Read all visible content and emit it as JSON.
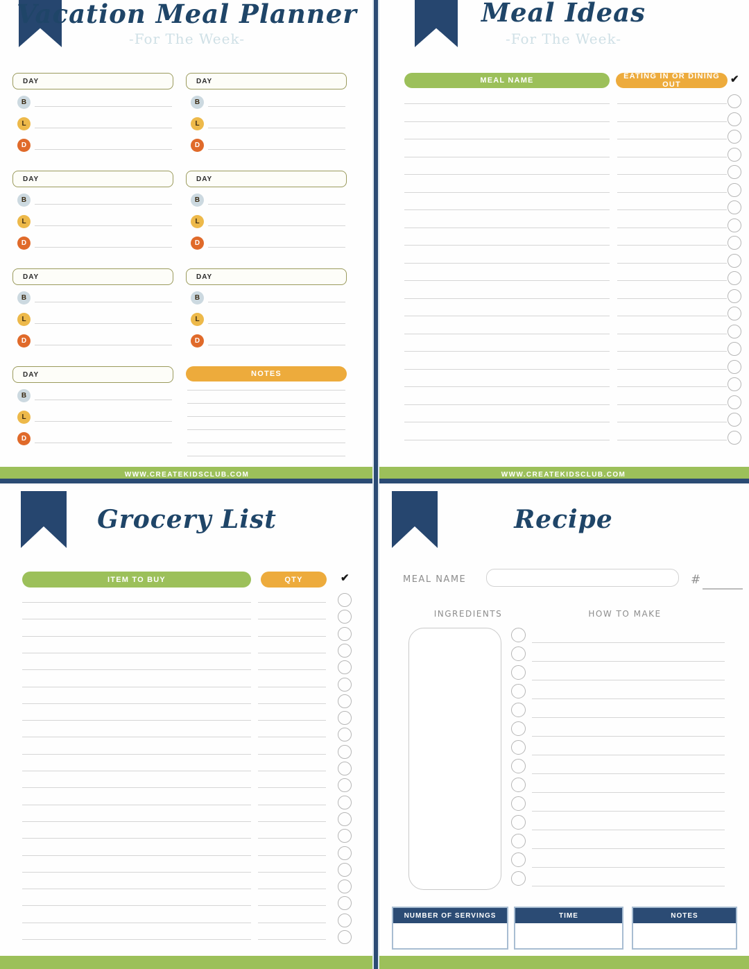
{
  "brand": {
    "footer_url": "WWW.CREATEKIDSCLUB.COM",
    "colors": {
      "navy": "#26466f",
      "green": "#9cc05a",
      "amber": "#edab3c",
      "olive": "#9a9a5c",
      "breakfast": "#ccd9e0",
      "lunch": "#edb94a",
      "dinner": "#e06a2a",
      "subtitle_blue": "#cfe0e6"
    }
  },
  "meal_planner": {
    "title": "Vacation Meal Planner",
    "subtitle": "-For The Week-",
    "day_label": "DAY",
    "meal_codes": {
      "breakfast": "B",
      "lunch": "L",
      "dinner": "D"
    },
    "day_count": 7,
    "notes_label": "NOTES",
    "notes_line_count": 6
  },
  "meal_ideas": {
    "title": "Meal Ideas",
    "subtitle": "-For The Week-",
    "columns": {
      "meal_name": "MEAL NAME",
      "eating_in_or_out": "EATING IN OR DINING OUT",
      "check": "✔"
    },
    "row_count": 20
  },
  "grocery_list": {
    "title": "Grocery List",
    "columns": {
      "item_to_buy": "ITEM TO BUY",
      "qty": "QTY",
      "check": "✔"
    },
    "row_count": 21
  },
  "recipe": {
    "title": "Recipe",
    "meal_name_label": "MEAL NAME",
    "servings_hash": "#",
    "ingredients_label": "INGREDIENTS",
    "how_to_make_label": "HOW TO MAKE",
    "step_count": 14,
    "bottom_boxes": [
      {
        "label": "NUMBER OF SERVINGS"
      },
      {
        "label": "TIME"
      },
      {
        "label": "NOTES"
      }
    ]
  }
}
